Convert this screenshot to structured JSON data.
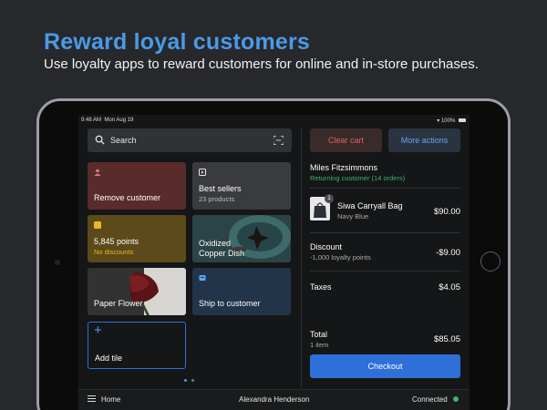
{
  "promo": {
    "title": "Reward loyal customers",
    "subtitle": "Use loyalty apps to reward customers for online and in-store purchases."
  },
  "status_bar": {
    "time": "9:48 AM",
    "date": "Mon Aug 19",
    "battery": "100%"
  },
  "search": {
    "placeholder": "Search"
  },
  "tiles": {
    "remove_customer": {
      "label": "Remove customer",
      "color": "#5a2b2b"
    },
    "best_sellers": {
      "label": "Best sellers",
      "sub": "23 products",
      "color": "#3a3b3d"
    },
    "points": {
      "label": "5,845 points",
      "sub": "No discounts",
      "color": "#5c4a1b"
    },
    "oxidized": {
      "label": "Oxidized Copper Dish"
    },
    "paper_flower": {
      "label": "Paper Flower"
    },
    "ship": {
      "label": "Ship to customer",
      "color": "#22344a"
    },
    "add": {
      "label": "Add tile",
      "symbol": "+"
    }
  },
  "cart": {
    "clear_label": "Clear cart",
    "more_label": "More actions",
    "customer_name": "Miles Fitzsimmons",
    "customer_status": "Returning customer (14 orders)",
    "item": {
      "qty": "1",
      "name": "Siwa Carryall Bag",
      "variant": "Navy Blue",
      "price": "$90.00"
    },
    "discount": {
      "label": "Discount",
      "detail": "-1,000 loyalty points",
      "amount": "-$9.00"
    },
    "taxes": {
      "label": "Taxes",
      "amount": "$4.05"
    },
    "total": {
      "label": "Total",
      "count": "1 item",
      "amount": "$85.05"
    },
    "checkout_label": "Checkout"
  },
  "bottom_bar": {
    "home_label": "Home",
    "staff_name": "Alexandra Henderson",
    "connection": "Connected"
  },
  "colors": {
    "accent": "#2f6fd8",
    "headline": "#4a9ae8",
    "success": "#3cb371",
    "danger": "#e0615a"
  }
}
